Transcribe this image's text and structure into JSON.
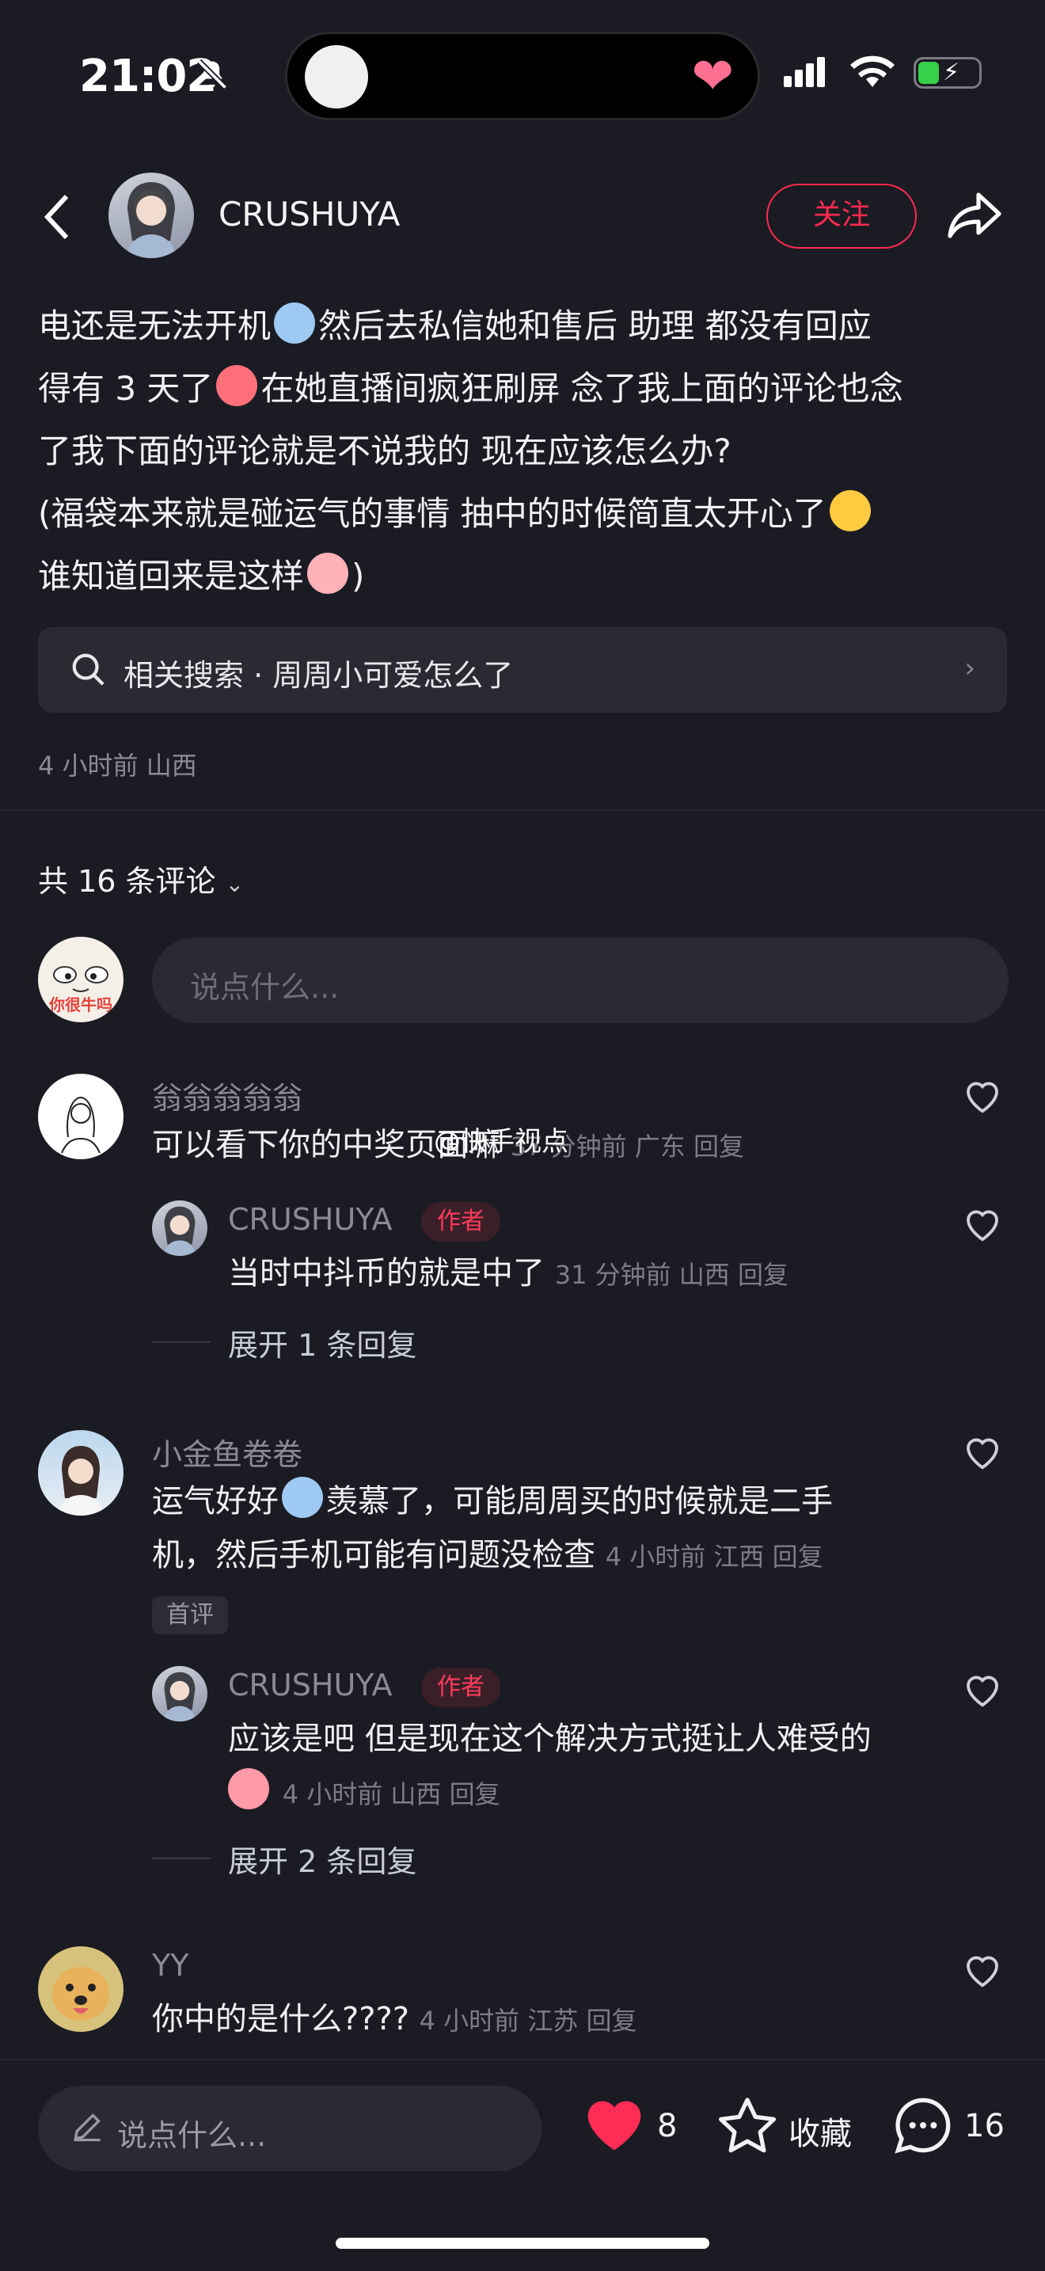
{
  "status_bar": {
    "time": "21:02"
  },
  "header": {
    "username": "CRUSHUYA",
    "follow_label": "关注"
  },
  "post": {
    "lines": [
      "电还是无法开机",
      "然后去私信她和售后 助理 都没有回应",
      "得有 3 天了",
      "在她直播间疯狂刷屏 念了我上面的评论也念",
      "了我下面的评论就是不说我的 现在应该怎么办?",
      "(福袋本来就是碰运气的事情 抽中的时候简直太开心了",
      "谁知道回来是这样",
      ")"
    ],
    "related_search": "相关搜索 · 周周小可爱怎么了",
    "meta": "4 小时前 山西"
  },
  "comments_header": {
    "count_label": "共 16 条评论",
    "input_placeholder": "说点什么...",
    "my_avatar_text": "你很牛吗"
  },
  "comments": [
    {
      "name": "翁翁翁翁翁",
      "text": "可以看下你的中奖页面嘛",
      "meta": "37 分钟前 广东 回复",
      "reply": {
        "name": "CRUSHUYA",
        "tag": "作者",
        "text": "当时中抖币的就是中了",
        "meta": "31 分钟前 山西 回复"
      },
      "expand": "展开 1 条回复"
    },
    {
      "name": "小金鱼卷卷",
      "text_line1_a": "运气好好",
      "text_line1_b": "羡慕了，可能周周买的时候就是二手",
      "text_line2": "机，然后手机可能有问题没检查",
      "meta": "4 小时前 江西 回复",
      "first_tag": "首评",
      "reply": {
        "name": "CRUSHUYA",
        "tag": "作者",
        "text": "应该是吧 但是现在这个解决方式挺让人难受的",
        "meta": "4 小时前 山西 回复"
      },
      "expand": "展开 2 条回复"
    },
    {
      "name": "YY",
      "text": "你中的是什么????",
      "meta": "4 小时前 江苏 回复"
    }
  ],
  "watermark": "@快手视点",
  "bottom_bar": {
    "placeholder": "说点什么...",
    "like_count": "8",
    "favorite_label": "收藏",
    "comment_count": "16"
  },
  "colors": {
    "background": "#1b1b23",
    "accent_red": "#ff2a50",
    "heart_red": "#ff2d55"
  }
}
